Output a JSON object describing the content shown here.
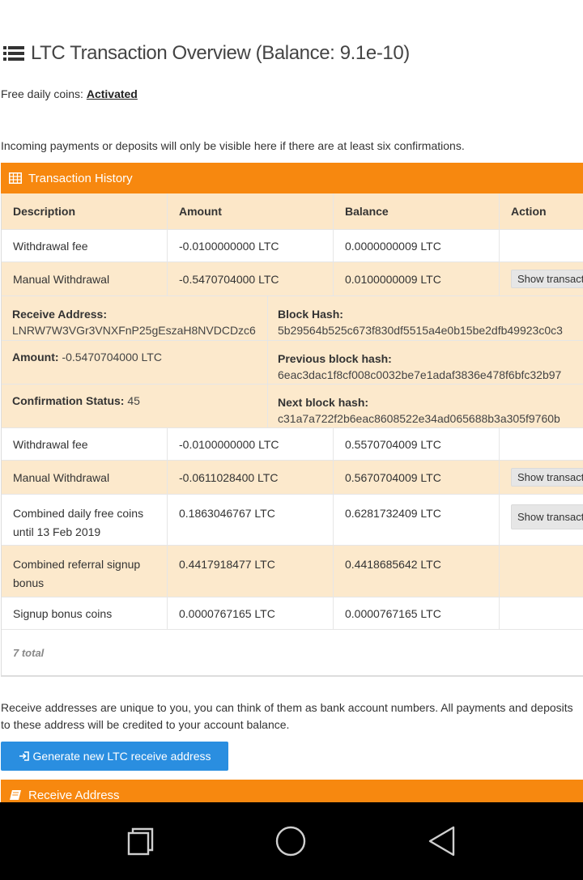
{
  "title": "LTC Transaction Overview (Balance: 9.1e-10)",
  "free_coins": {
    "label": "Free daily coins:",
    "status": "Activated"
  },
  "info_text": "Incoming payments or deposits will only be visible here if there are at least six confirmations.",
  "history_panel": {
    "title": "Transaction History",
    "columns": [
      "Description",
      "Amount",
      "Balance",
      "Action"
    ],
    "rows": [
      {
        "description": "Withdrawal fee",
        "amount": "-0.0100000000 LTC",
        "balance": "0.0000000009 LTC",
        "action": ""
      },
      {
        "description": "Manual Withdrawal",
        "amount": "-0.5470704000 LTC",
        "balance": "0.0100000009 LTC",
        "action": "Show transaction"
      },
      {
        "description": "Withdrawal fee",
        "amount": "-0.0100000000 LTC",
        "balance": "0.5570704009 LTC",
        "action": ""
      },
      {
        "description": "Manual Withdrawal",
        "amount": "-0.0611028400 LTC",
        "balance": "0.5670704009 LTC",
        "action": "Show transaction"
      },
      {
        "description": "Combined daily free coins until 13 Feb 2019",
        "amount": "0.1863046767 LTC",
        "balance": "0.6281732409 LTC",
        "action": "Show transaction"
      },
      {
        "description": "Combined referral signup bonus",
        "amount": "0.4417918477 LTC",
        "balance": "0.4418685642 LTC",
        "action": ""
      },
      {
        "description": "Signup bonus coins",
        "amount": "0.0000767165 LTC",
        "balance": "0.0000767165 LTC",
        "action": ""
      }
    ],
    "details": {
      "receive_address_label": "Receive Address:",
      "receive_address": "LNRW7W3VGr3VNXFnP25gEszaH8NVDCDzc6",
      "amount_label": "Amount:",
      "amount": "-0.5470704000 LTC",
      "confirmation_label": "Confirmation Status:",
      "confirmation": "45",
      "block_hash_label": "Block Hash:",
      "block_hash": "5b29564b525c673f830df5515a4e0b15be2dfb49923c0c3",
      "prev_hash_label": "Previous block hash:",
      "prev_hash": "6eac3dac1f8cf008c0032be7e1adaf3836e478f6bfc32b97",
      "next_hash_label": "Next block hash:",
      "next_hash": "c31a7a722f2b6eac8608522e34ad065688b3a305f9760b"
    },
    "total": "7 total"
  },
  "address_note": "Receive addresses are unique to you, you can think of them as bank account numbers. All payments and deposits to these address will be credited to your account balance.",
  "generate_button": "Generate new LTC receive address",
  "receive_panel": {
    "title": "Receive Address"
  },
  "colors": {
    "accent": "#f7880f",
    "button_blue": "#2a8ee0",
    "row_tan": "#fce9cc"
  },
  "icons": {
    "title": "list-icon",
    "history": "table-icon",
    "generate": "sign-in-icon",
    "receive": "book-icon",
    "nav": [
      "recent-apps-icon",
      "home-icon",
      "back-icon"
    ]
  }
}
